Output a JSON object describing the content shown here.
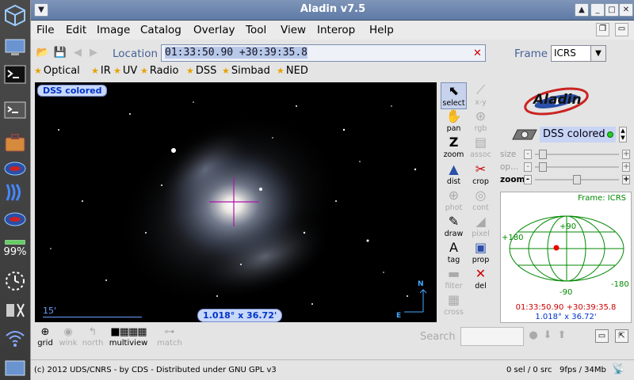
{
  "window": {
    "title": "Aladin v7.5",
    "menu": [
      "File",
      "Edit",
      "Image",
      "Catalog",
      "Overlay",
      "Tool",
      "View",
      "Interop",
      "Help"
    ]
  },
  "dock": {
    "battery_percent": "99%"
  },
  "location": {
    "label": "Location",
    "value": "01:33:50.90 +30:39:35.8",
    "clear_icon": "✕"
  },
  "frame": {
    "label": "Frame",
    "value": "ICRS"
  },
  "bands": [
    "Optical",
    "IR",
    "UV",
    "Radio",
    "DSS",
    "Simbad",
    "NED"
  ],
  "view": {
    "layer_label": "DSS colored",
    "scale_label": "15'",
    "fov_label": "1.018° x 36.72'",
    "compass_n": "N",
    "compass_e": "E"
  },
  "tools": [
    {
      "label": "select",
      "icon": "cursor-icon",
      "enabled": true
    },
    {
      "label": "x-y",
      "icon": "xy-plot-icon",
      "enabled": false
    },
    {
      "label": "pan",
      "icon": "hand-icon",
      "enabled": true
    },
    {
      "label": "rgb",
      "icon": "rgb-icon",
      "enabled": false
    },
    {
      "label": "zoom",
      "icon": "zoom-icon",
      "enabled": true
    },
    {
      "label": "assoc",
      "icon": "film-icon",
      "enabled": false
    },
    {
      "label": "dist",
      "icon": "distance-icon",
      "enabled": true
    },
    {
      "label": "crop",
      "icon": "scissors-icon",
      "enabled": true
    },
    {
      "label": "phot",
      "icon": "phot-icon",
      "enabled": false
    },
    {
      "label": "cont",
      "icon": "contour-icon",
      "enabled": false
    },
    {
      "label": "draw",
      "icon": "pencil-icon",
      "enabled": true
    },
    {
      "label": "pixel",
      "icon": "pixel-icon",
      "enabled": false
    },
    {
      "label": "tag",
      "icon": "tag-icon",
      "enabled": true
    },
    {
      "label": "prop",
      "icon": "properties-icon",
      "enabled": true
    },
    {
      "label": "filter",
      "icon": "filter-icon",
      "enabled": false
    },
    {
      "label": "del",
      "icon": "delete-icon",
      "enabled": true
    },
    {
      "label": "cross",
      "icon": "crossmatch-icon",
      "enabled": false
    }
  ],
  "logo": {
    "text": "Aladin"
  },
  "layer": {
    "name": "DSS colored"
  },
  "sliders": [
    {
      "label": "size",
      "value": 0.05
    },
    {
      "label": "op...",
      "value": 0.05
    },
    {
      "label": "zoom",
      "value": 0.5
    }
  ],
  "allsky": {
    "frame_label": "Frame: ICRS",
    "lat_top": "+90",
    "lat_bottom": "-90",
    "lon_left": "+180",
    "lon_right": "-180",
    "coord": "01:33:50.90 +30:39:35.8",
    "fov": "1.018° x 36.72'"
  },
  "bottom_tools": [
    {
      "label": "grid",
      "enabled": true
    },
    {
      "label": "wink",
      "enabled": false
    },
    {
      "label": "north",
      "enabled": false
    },
    {
      "label": "multiview",
      "enabled": true
    },
    {
      "label": "match",
      "enabled": false
    }
  ],
  "search": {
    "label": "Search",
    "value": ""
  },
  "status": {
    "copyright": "(c) 2012 UDS/CNRS - by CDS - Distributed under GNU GPL v3",
    "selection": "0 sel / 0 src",
    "performance": "9fps / 34Mb"
  }
}
